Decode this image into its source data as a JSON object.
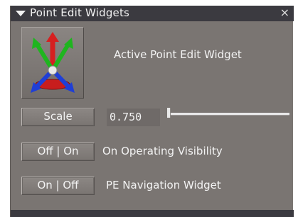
{
  "panel": {
    "title": "Point Edit Widgets",
    "collapse_icon": "caret-down-icon",
    "close_glyph": "×"
  },
  "widget": {
    "icon": "transform-gizmo-icon",
    "label": "Active  Point Edit Widget"
  },
  "scale": {
    "button_label": "Scale",
    "value": "0.750",
    "slider_fraction": 0.0
  },
  "visibility": {
    "toggle_label": "Off | On",
    "label": "On Operating Visibility"
  },
  "navigation": {
    "toggle_label": "On | Off",
    "label": "PE Navigation Widget"
  },
  "colors": {
    "panel_bg": "#7a7572",
    "titlebar_bg": "#3b3a40",
    "text": "#f3f3f3",
    "gizmo_red": "#d62020",
    "gizmo_green": "#1fb51f",
    "gizmo_blue": "#1f3fd6"
  }
}
